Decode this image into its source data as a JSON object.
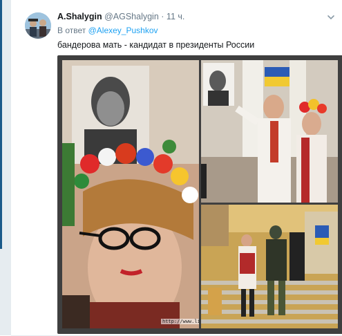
{
  "tweet": {
    "author_name": "A.Shalygin",
    "author_handle": "@AGShalygin",
    "separator": "·",
    "timestamp": "11 ч.",
    "reply_prefix": "В ответ",
    "reply_to": "@Alexey_Pushkov",
    "text": "бандерова мать - кандидат в президенты России",
    "menu_icon": "chevron-down-icon"
  },
  "media": {
    "watermark": "http://www.li"
  },
  "colors": {
    "link": "#1da1f2",
    "text": "#14171a",
    "muted": "#657786",
    "rail": "#1b5a8a"
  }
}
